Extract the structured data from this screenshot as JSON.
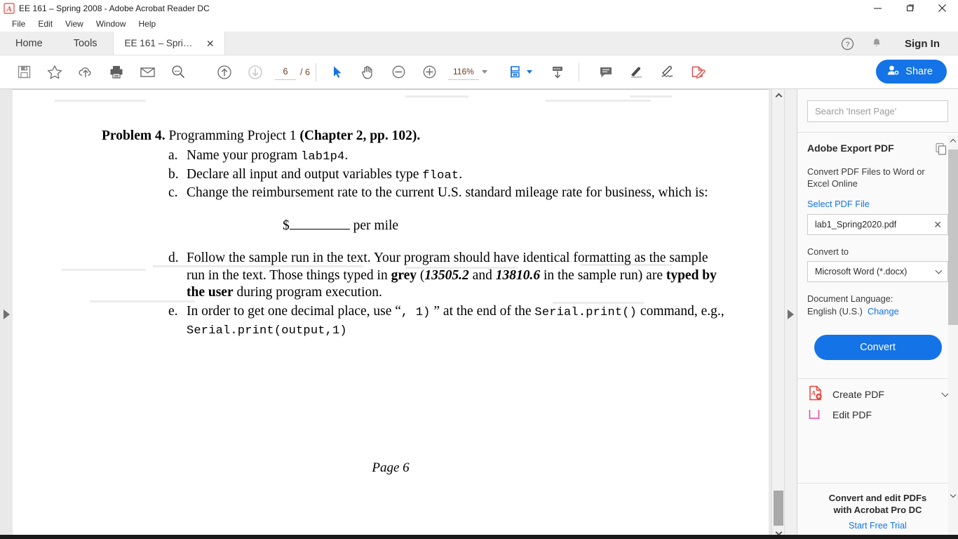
{
  "window": {
    "title": "EE 161 – Spring 2008 - Adobe Acrobat Reader DC",
    "app_icon": "acrobat-icon",
    "controls": {
      "minimize": "minimize-icon",
      "maximize": "maximize-icon",
      "close": "close-icon"
    }
  },
  "menubar": {
    "items": [
      "File",
      "Edit",
      "View",
      "Window",
      "Help"
    ]
  },
  "tabstrip": {
    "home": "Home",
    "tools": "Tools",
    "doc_tab": "EE 161 – Spring 20...",
    "close_glyph": "✕",
    "help_icon": "help-circle-icon",
    "bell_icon": "notification-bell-icon",
    "sign_in": "Sign In"
  },
  "toolbar": {
    "icons": [
      "save-icon",
      "add-to-favorites-star-icon",
      "cloud-upload-icon",
      "print-icon",
      "email-icon",
      "search-icon"
    ],
    "nav": {
      "prev_page_icon": "previous-page-icon",
      "next_page_icon": "next-page-icon"
    },
    "page_current": "6",
    "page_total": "/ 6",
    "tools": {
      "select_icon": "select-cursor-icon",
      "pan_icon": "hand-pan-icon",
      "zoom_out_icon": "zoom-out-icon",
      "zoom_in_icon": "zoom-in-icon"
    },
    "zoom_level": "116%",
    "fit_page_icon": "fit-page-icon",
    "scroll_mode_icon": "page-scrolling-icon",
    "annot": {
      "comment_icon": "add-comment-icon",
      "highlight_icon": "highlight-text-icon",
      "draw_icon": "draw-freehand-icon",
      "fill_sign_icon": "fill-and-sign-icon"
    },
    "share_label": "Share",
    "share_icon": "share-person-icon",
    "share_color": "#1473e6"
  },
  "document": {
    "problem_bold_1": "Problem 4.",
    "problem_normal": " Programming Project 1 ",
    "problem_bold_2": "(Chapter 2, pp. 102).",
    "items": [
      {
        "mark": "a.",
        "pre": "Name your program ",
        "code": "lab1p4",
        "post": "."
      },
      {
        "mark": "b.",
        "pre": "Declare all input and output variables type ",
        "code": "float",
        "post": "."
      },
      {
        "mark": "c.",
        "pre": "Change the reimbursement rate to the current U.S. standard mileage rate for business, which is:",
        "code": "",
        "post": ""
      }
    ],
    "dollar_prefix": "$",
    "dollar_suffix": " per mile",
    "item_d": {
      "mark": "d.",
      "p1": "Follow the sample run in the text. Your program should have identical formatting as the sample run in the text.  Those things typed in ",
      "b1": "grey",
      "p2": " (",
      "i1": "13505.2",
      "p3": " and ",
      "i2": "13810.6",
      "p4": " in the sample run) are ",
      "b2": "typed by the user",
      "p5": " during program execution."
    },
    "item_e": {
      "mark": "e.",
      "p1": "In order to get one decimal place, use “",
      "c1": ", 1)",
      "p2": " ” at the end of the ",
      "c2": "Serial.print()",
      "p3": " command, e.g., ",
      "c3": "Serial.print(output,1)"
    },
    "footer": "Page 6"
  },
  "sidebar": {
    "search_placeholder": "Search 'Insert Page'",
    "export": {
      "title": "Adobe Export PDF",
      "copy_icon": "export-pdf-icon",
      "description": "Convert PDF Files to Word or Excel Online",
      "select_link": "Select PDF File",
      "file_name": "lab1_Spring2020.pdf",
      "file_clear_glyph": "✕",
      "convert_to_label": "Convert to",
      "convert_to_value": "Microsoft Word (*.docx)",
      "doc_language_label": "Document Language:",
      "doc_language_value": "English (U.S.)",
      "change_link": "Change",
      "convert_button": "Convert",
      "convert_color": "#1473e6"
    },
    "tools": [
      {
        "label": "Create PDF",
        "icon": "create-pdf-icon"
      },
      {
        "label": "Edit PDF",
        "icon": "edit-pdf-icon"
      }
    ],
    "promo": {
      "line1": "Convert and edit PDFs",
      "line2": "with Acrobat Pro DC",
      "link": "Start Free Trial"
    }
  },
  "panels": {
    "left_expand_icon": "expand-left-panel-icon",
    "right_expand_icon": "expand-right-panel-icon"
  }
}
